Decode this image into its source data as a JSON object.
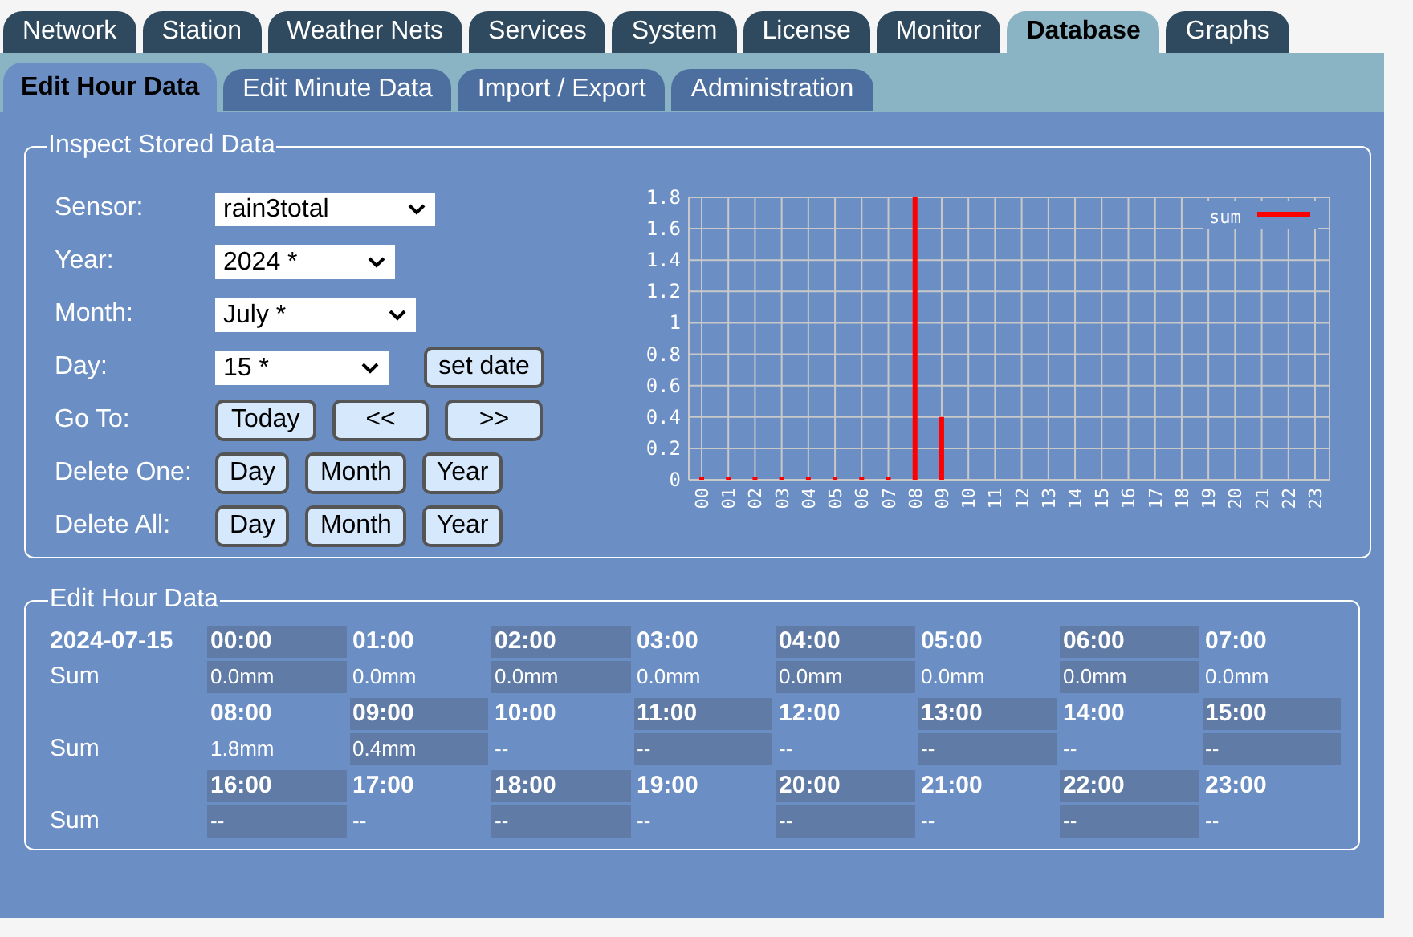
{
  "tabs": [
    {
      "label": "Network",
      "selected": false
    },
    {
      "label": "Station",
      "selected": false
    },
    {
      "label": "Weather Nets",
      "selected": false
    },
    {
      "label": "Services",
      "selected": false
    },
    {
      "label": "System",
      "selected": false
    },
    {
      "label": "License",
      "selected": false
    },
    {
      "label": "Monitor",
      "selected": false
    },
    {
      "label": "Database",
      "selected": true
    },
    {
      "label": "Graphs",
      "selected": false
    }
  ],
  "subtabs": [
    {
      "label": "Edit Hour Data",
      "selected": true
    },
    {
      "label": "Edit Minute Data",
      "selected": false
    },
    {
      "label": "Import / Export",
      "selected": false
    },
    {
      "label": "Administration",
      "selected": false
    }
  ],
  "inspect": {
    "title": "Inspect Stored Data",
    "rows": [
      {
        "label": "Sensor:",
        "kind": "select",
        "value": "rain3total"
      },
      {
        "label": "Year:",
        "kind": "select",
        "value": "2024 *"
      },
      {
        "label": "Month:",
        "kind": "select",
        "value": "July *"
      },
      {
        "label": "Day:",
        "kind": "select",
        "value": "15 *",
        "button": "set date"
      },
      {
        "label": "Go To:",
        "kind": "buttons",
        "buttons": [
          "Today",
          "<<",
          ">>"
        ]
      },
      {
        "label": "Delete One:",
        "kind": "buttons",
        "buttons": [
          "Day",
          "Month",
          "Year"
        ]
      },
      {
        "label": "Delete All:",
        "kind": "buttons",
        "buttons": [
          "Day",
          "Month",
          "Year"
        ]
      }
    ],
    "chart_data": {
      "type": "bar",
      "categories": [
        "00",
        "01",
        "02",
        "03",
        "04",
        "05",
        "06",
        "07",
        "08",
        "09",
        "10",
        "11",
        "12",
        "13",
        "14",
        "15",
        "16",
        "17",
        "18",
        "19",
        "20",
        "21",
        "22",
        "23"
      ],
      "series": [
        {
          "name": "sum",
          "color": "#ff0000",
          "values": [
            0,
            0,
            0,
            0,
            0,
            0,
            0,
            0,
            1.8,
            0.4,
            null,
            null,
            null,
            null,
            null,
            null,
            null,
            null,
            null,
            null,
            null,
            null,
            null,
            null
          ]
        }
      ],
      "grid": true,
      "ylim": [
        0,
        1.8
      ],
      "yticks": [
        0,
        0.2,
        0.4,
        0.6,
        0.8,
        1,
        1.2,
        1.4,
        1.6,
        1.8
      ]
    }
  },
  "hour_data": {
    "title": "Edit Hour Data",
    "date": "2024-07-15",
    "blocks": [
      {
        "label": "Sum",
        "hours": [
          {
            "time": "00:00",
            "value": "0.0mm"
          },
          {
            "time": "01:00",
            "value": "0.0mm"
          },
          {
            "time": "02:00",
            "value": "0.0mm"
          },
          {
            "time": "03:00",
            "value": "0.0mm"
          },
          {
            "time": "04:00",
            "value": "0.0mm"
          },
          {
            "time": "05:00",
            "value": "0.0mm"
          },
          {
            "time": "06:00",
            "value": "0.0mm"
          },
          {
            "time": "07:00",
            "value": "0.0mm"
          }
        ]
      },
      {
        "label": "Sum",
        "hours": [
          {
            "time": "08:00",
            "value": "1.8mm"
          },
          {
            "time": "09:00",
            "value": "0.4mm"
          },
          {
            "time": "10:00",
            "value": "--"
          },
          {
            "time": "11:00",
            "value": "--"
          },
          {
            "time": "12:00",
            "value": "--"
          },
          {
            "time": "13:00",
            "value": "--"
          },
          {
            "time": "14:00",
            "value": "--"
          },
          {
            "time": "15:00",
            "value": "--"
          }
        ]
      },
      {
        "label": "Sum",
        "hours": [
          {
            "time": "16:00",
            "value": "--"
          },
          {
            "time": "17:00",
            "value": "--"
          },
          {
            "time": "18:00",
            "value": "--"
          },
          {
            "time": "19:00",
            "value": "--"
          },
          {
            "time": "20:00",
            "value": "--"
          },
          {
            "time": "21:00",
            "value": "--"
          },
          {
            "time": "22:00",
            "value": "--"
          },
          {
            "time": "23:00",
            "value": "--"
          }
        ]
      }
    ]
  }
}
